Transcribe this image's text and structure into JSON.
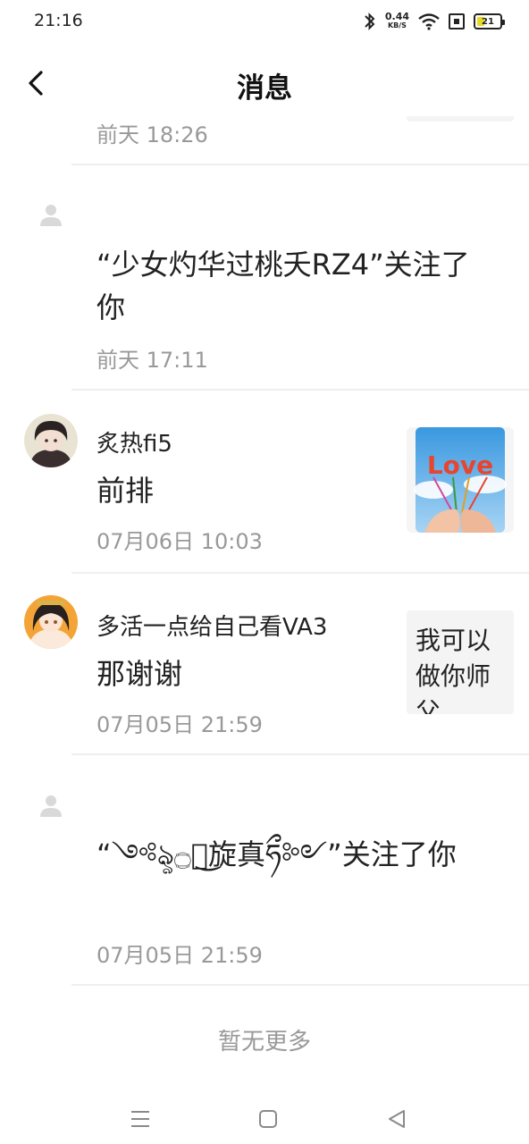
{
  "status_bar": {
    "time": "21:16",
    "net_speed": "0.44",
    "net_unit": "KB/S",
    "battery": "21",
    "icons": [
      "bluetooth-icon",
      "wifi-icon",
      "sim-icon",
      "battery-icon"
    ]
  },
  "header": {
    "title": "消息",
    "back_icon": "chevron-left-icon"
  },
  "messages": [
    {
      "time": "前天 18:26"
    },
    {
      "type": "follow",
      "text": "“少女灼华过桃夭RZ4”关注了你",
      "time": "前天 17:11"
    },
    {
      "type": "comment",
      "sender": "炙热fi5",
      "text": "前排",
      "time": "07月06日 10:03",
      "thumb_text": "Love"
    },
    {
      "type": "comment",
      "sender": "多活一点给自己看VA3",
      "text": "那谢谢",
      "time": "07月05日 21:59",
      "preview": "我可以做你师父"
    },
    {
      "type": "follow",
      "text": "“༺ৡ۝ཧ͜旋真ཧྀ༻”关注了你",
      "time": "07月05日 21:59"
    }
  ],
  "footer": {
    "no_more": "暂无更多"
  },
  "nav_bar": {
    "icons": [
      "menu-icon",
      "home-square-icon",
      "back-triangle-icon"
    ]
  },
  "colors": {
    "background": "#ffffff",
    "divider": "#efefef",
    "secondary_text": "#999999",
    "placeholder_avatar": "#d9d9d9"
  }
}
